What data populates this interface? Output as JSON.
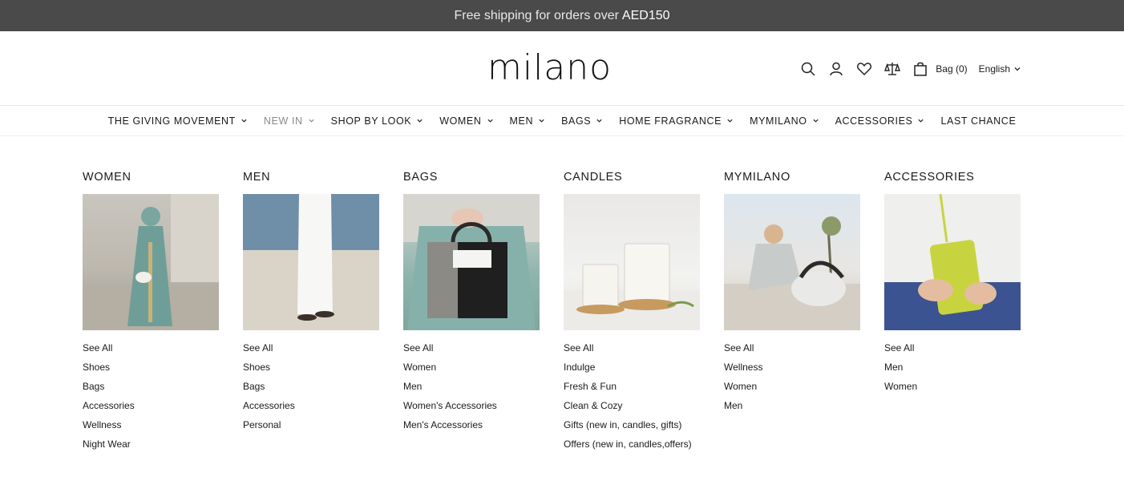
{
  "announcement": {
    "text": "Free shipping for orders over",
    "amount": "AED150"
  },
  "header": {
    "logo": "milano",
    "icons": [
      "search-icon",
      "account-icon",
      "wishlist-heart-icon",
      "compare-scale-icon",
      "bag-icon"
    ],
    "bag_label": "Bag (0)",
    "language": "English"
  },
  "nav": {
    "items": [
      {
        "label": "THE GIVING MOVEMENT",
        "has_dropdown": true,
        "active": false
      },
      {
        "label": "NEW IN",
        "has_dropdown": true,
        "active": true
      },
      {
        "label": "SHOP BY LOOK",
        "has_dropdown": true,
        "active": false
      },
      {
        "label": "WOMEN",
        "has_dropdown": true,
        "active": false
      },
      {
        "label": "MEN",
        "has_dropdown": true,
        "active": false
      },
      {
        "label": "BAGS",
        "has_dropdown": true,
        "active": false
      },
      {
        "label": "HOME FRAGRANCE",
        "has_dropdown": true,
        "active": false
      },
      {
        "label": "MYMILANO",
        "has_dropdown": true,
        "active": false
      },
      {
        "label": "ACCESSORIES",
        "has_dropdown": true,
        "active": false
      },
      {
        "label": "LAST CHANCE",
        "has_dropdown": false,
        "active": false
      }
    ]
  },
  "mega_menu": {
    "columns": [
      {
        "title": "WOMEN",
        "image": "women-teal-abaya-photo",
        "links": [
          "See All",
          "Shoes",
          "Bags",
          "Accessories",
          "Wellness",
          "Night Wear"
        ]
      },
      {
        "title": "MEN",
        "image": "men-white-kandura-photo",
        "links": [
          "See All",
          "Shoes",
          "Bags",
          "Accessories",
          "Personal"
        ]
      },
      {
        "title": "BAGS",
        "image": "handbag-photo",
        "links": [
          "See All",
          "Women",
          "Men",
          "Women's Accessories",
          "Men's Accessories"
        ]
      },
      {
        "title": "CANDLES",
        "image": "candles-photo",
        "links": [
          "See All",
          "Indulge",
          "Fresh & Fun",
          "Clean & Cozy",
          "Gifts (new in, candles, gifts)",
          "Offers (new in, candles,offers)"
        ]
      },
      {
        "title": "MYMILANO",
        "image": "gym-bag-woman-photo",
        "links": [
          "See All",
          "Wellness",
          "Women",
          "Men"
        ]
      },
      {
        "title": "ACCESSORIES",
        "image": "phone-pouch-photo",
        "links": [
          "See All",
          "Men",
          "Women"
        ]
      }
    ]
  },
  "colors": {
    "announcement_bg": "#4a4a4a",
    "active_nav": "#8a8a8a",
    "text": "#1a1a1a"
  }
}
